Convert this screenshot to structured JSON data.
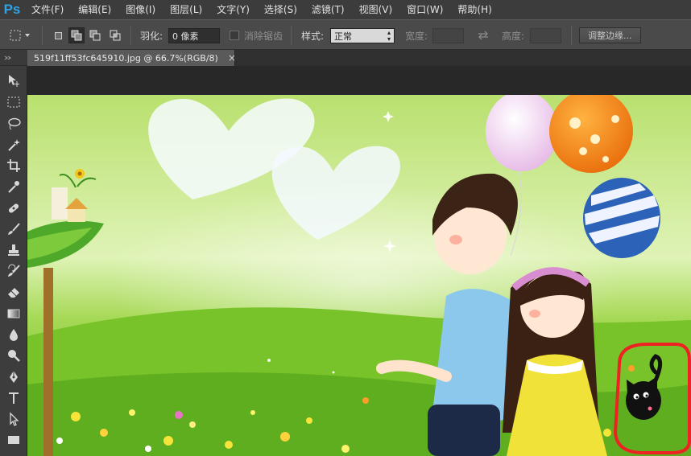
{
  "app": {
    "logo": "Ps",
    "menus": [
      "文件(F)",
      "编辑(E)",
      "图像(I)",
      "图层(L)",
      "文字(Y)",
      "选择(S)",
      "滤镜(T)",
      "视图(V)",
      "窗口(W)",
      "帮助(H)"
    ]
  },
  "options": {
    "feather_label": "羽化:",
    "feather_value": "0 像素",
    "antialias_label": "消除锯齿",
    "style_label": "样式:",
    "style_value": "正常",
    "width_label": "宽度:",
    "height_label": "高度:",
    "refine_edge_button": "调整边缘..."
  },
  "document": {
    "tab_title": "519f11ff53fc645910.jpg @ 66.7%(RGB/8)",
    "close_symbol": "×"
  },
  "tools": [
    "move-tool",
    "marquee-tool",
    "lasso-tool",
    "magic-wand-tool",
    "crop-tool",
    "eyedropper-tool",
    "healing-brush-tool",
    "brush-tool",
    "clone-stamp-tool",
    "history-brush-tool",
    "eraser-tool",
    "gradient-tool",
    "blur-tool",
    "dodge-tool",
    "pen-tool",
    "type-tool",
    "path-selection-tool",
    "shape-tool"
  ],
  "canvas": {
    "sky_color": "#cdeb9c",
    "grass_color": "#7ccb2b",
    "highlight_color": "#ee2222"
  }
}
